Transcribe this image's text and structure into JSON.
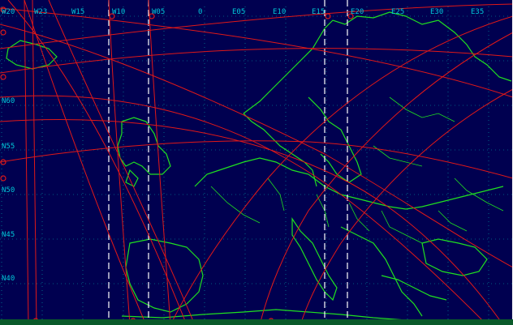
{
  "map": {
    "top_labels": [
      "W20",
      "W23",
      "W15",
      "W10",
      "W05",
      "0",
      "E05",
      "E10",
      "E15",
      "E20",
      "E25",
      "E30",
      "E35"
    ],
    "left_labels": [
      "N60",
      "N55",
      "N50",
      "N45",
      "N40"
    ],
    "colors": {
      "ocean": "#000050",
      "coast": "#20e020",
      "grid": "#00b0b0",
      "track": "#e01818",
      "marker": "#ffffff",
      "label": "#00c8d8"
    }
  }
}
